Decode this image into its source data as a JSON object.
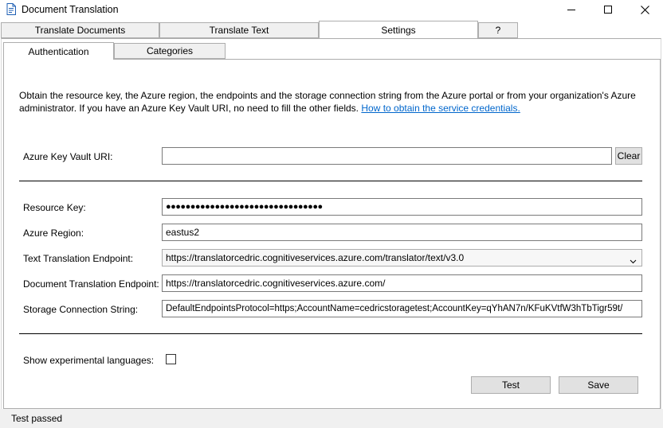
{
  "window": {
    "title": "Document Translation",
    "icons": [
      "app-document-icon",
      "minimize-icon",
      "maximize-icon",
      "close-icon"
    ]
  },
  "tabs": [
    {
      "label": "Translate Documents"
    },
    {
      "label": "Translate Text"
    },
    {
      "label": "Settings",
      "active": true
    },
    {
      "label": "?"
    }
  ],
  "subtabs": [
    {
      "label": "Authentication",
      "active": true
    },
    {
      "label": "Categories"
    }
  ],
  "intro": {
    "text": "Obtain the resource key, the Azure region, the endpoints and the storage connection string from the Azure portal or from your organization's Azure administrator. If you have an Azure Key Vault URI, no need to fill the other fields. ",
    "link": "How to obtain the service credentials."
  },
  "form": {
    "key_vault_label": "Azure Key Vault URI:",
    "key_vault_value": "",
    "clear_label": "Clear",
    "resource_key_label": "Resource Key:",
    "resource_key_value": "●●●●●●●●●●●●●●●●●●●●●●●●●●●●●●●●",
    "region_label": "Azure Region:",
    "region_value": "eastus2",
    "text_endpoint_label": "Text Translation Endpoint:",
    "text_endpoint_value": "https://translatorcedric.cognitiveservices.azure.com/translator/text/v3.0",
    "doc_endpoint_label": "Document Translation Endpoint:",
    "doc_endpoint_value": "https://translatorcedric.cognitiveservices.azure.com/",
    "storage_label": "Storage Connection String:",
    "storage_value": "DefaultEndpointsProtocol=https;AccountName=cedricstoragetest;AccountKey=qYhAN7n/KFuKVtfW3hTbTigr59t/",
    "experimental_label": "Show experimental languages:",
    "experimental_checked": false
  },
  "buttons": {
    "test_label": "Test",
    "save_label": "Save"
  },
  "status": {
    "text": "Test passed"
  }
}
